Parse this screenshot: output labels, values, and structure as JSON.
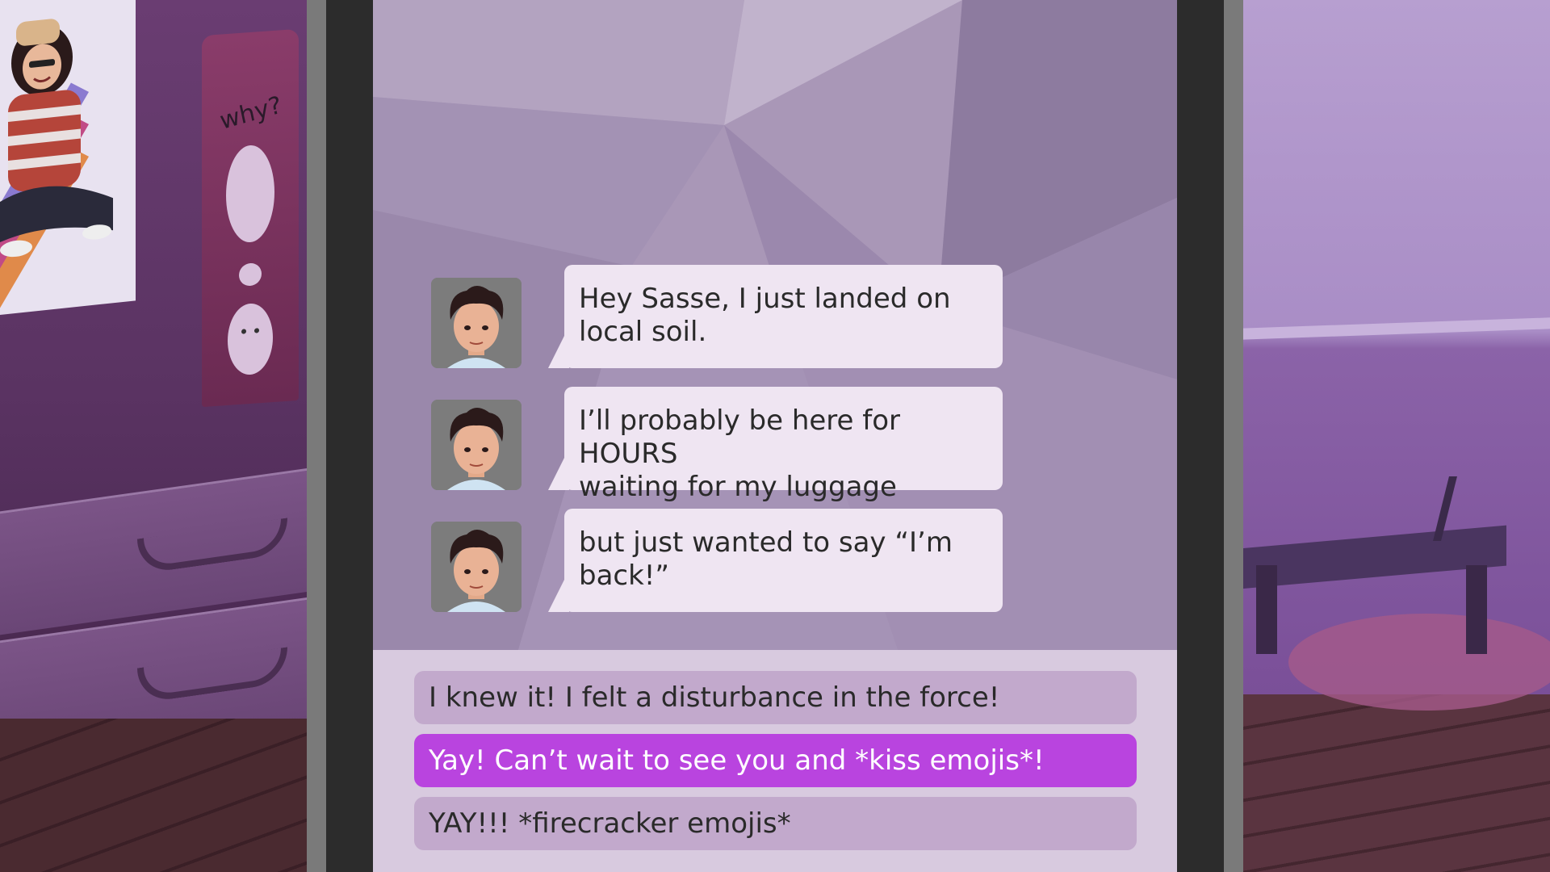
{
  "background": {
    "shirt_scribble": "why?"
  },
  "conversation": {
    "messages": [
      {
        "sender_icon": "boy-avatar-icon",
        "text": "Hey Sasse, I just landed on\nlocal soil."
      },
      {
        "sender_icon": "boy-avatar-icon",
        "text": "I’ll probably be here for HOURS\nwaiting for my luggage"
      },
      {
        "sender_icon": "boy-avatar-icon",
        "text": "but just wanted to say “I’m\nback!”"
      }
    ]
  },
  "choices": [
    {
      "label": "I knew it! I felt a disturbance in the force!",
      "selected": false
    },
    {
      "label": "Yay! Can’t wait to see you and *kiss emojis*!",
      "selected": true
    },
    {
      "label": "YAY!!! *firecracker emojis*",
      "selected": false
    }
  ],
  "colors": {
    "selected_choice": "#b944df",
    "choice": "#c2a9cc",
    "bubble": "#efe5f2",
    "screen": "#a997b7"
  }
}
